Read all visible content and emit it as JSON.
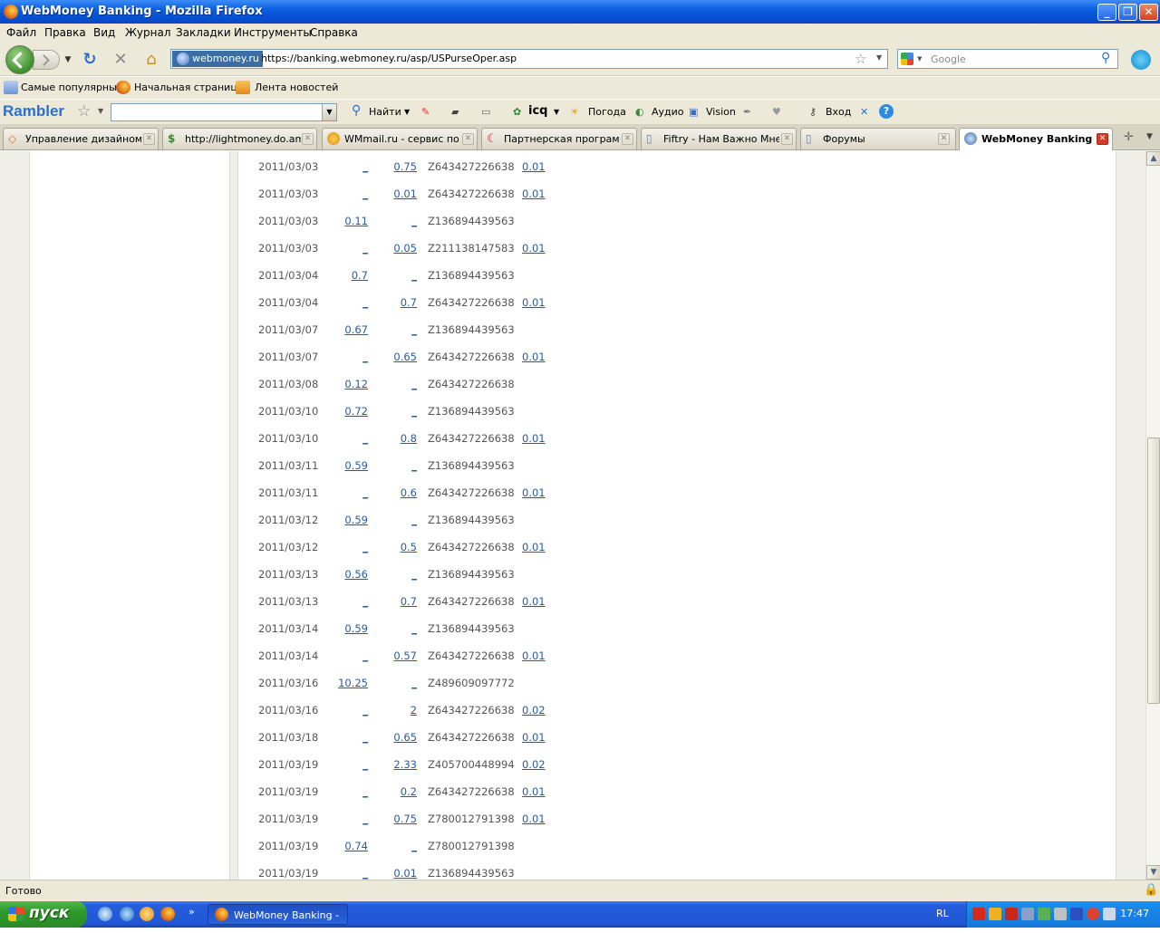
{
  "window": {
    "title": "WebMoney Banking - Mozilla Firefox"
  },
  "menu": [
    "Файл",
    "Правка",
    "Вид",
    "Журнал",
    "Закладки",
    "Инструменты",
    "Справка"
  ],
  "nav": {
    "site_identity": "webmoney.ru",
    "url": "https://banking.webmoney.ru/asp/USPurseOper.asp",
    "search_placeholder": "Google"
  },
  "bookmarks": [
    "Самые популярные",
    "Начальная страница",
    "Лента новостей"
  ],
  "rambler": {
    "logo": "Rambler",
    "find": "Найти",
    "icq": "icq",
    "weather": "Погода",
    "audio": "Аудио",
    "vision": "Vision",
    "login": "Вход"
  },
  "tabs": [
    {
      "label": "Управление дизайном...",
      "active": false
    },
    {
      "label": "http://lightmoney.do.am/",
      "active": false
    },
    {
      "label": "WMmail.ru - сервис по...",
      "active": false
    },
    {
      "label": "Партнерская програм...",
      "active": false
    },
    {
      "label": "Fiftry - Нам Важно Мне...",
      "active": false
    },
    {
      "label": "Форумы",
      "active": false
    },
    {
      "label": "WebMoney Banking",
      "active": true
    }
  ],
  "operations": [
    {
      "date": "2011/03/03",
      "in": "_",
      "out": "0.75",
      "purse": "Z643427226638",
      "fee": "0.01"
    },
    {
      "date": "2011/03/03",
      "in": "_",
      "out": "0.01",
      "purse": "Z643427226638",
      "fee": "0.01"
    },
    {
      "date": "2011/03/03",
      "in": "0.11",
      "out": "_",
      "purse": "Z136894439563",
      "fee": ""
    },
    {
      "date": "2011/03/03",
      "in": "_",
      "out": "0.05",
      "purse": "Z211138147583",
      "fee": "0.01"
    },
    {
      "date": "2011/03/04",
      "in": "0.7",
      "out": "_",
      "purse": "Z136894439563",
      "fee": ""
    },
    {
      "date": "2011/03/04",
      "in": "_",
      "out": "0.7",
      "purse": "Z643427226638",
      "fee": "0.01"
    },
    {
      "date": "2011/03/07",
      "in": "0.67",
      "out": "_",
      "purse": "Z136894439563",
      "fee": ""
    },
    {
      "date": "2011/03/07",
      "in": "_",
      "out": "0.65",
      "purse": "Z643427226638",
      "fee": "0.01"
    },
    {
      "date": "2011/03/08",
      "in": "0.12",
      "out": "_",
      "purse": "Z643427226638",
      "fee": ""
    },
    {
      "date": "2011/03/10",
      "in": "0.72",
      "out": "_",
      "purse": "Z136894439563",
      "fee": ""
    },
    {
      "date": "2011/03/10",
      "in": "_",
      "out": "0.8",
      "purse": "Z643427226638",
      "fee": "0.01"
    },
    {
      "date": "2011/03/11",
      "in": "0.59",
      "out": "_",
      "purse": "Z136894439563",
      "fee": ""
    },
    {
      "date": "2011/03/11",
      "in": "_",
      "out": "0.6",
      "purse": "Z643427226638",
      "fee": "0.01"
    },
    {
      "date": "2011/03/12",
      "in": "0.59",
      "out": "_",
      "purse": "Z136894439563",
      "fee": ""
    },
    {
      "date": "2011/03/12",
      "in": "_",
      "out": "0.5",
      "purse": "Z643427226638",
      "fee": "0.01"
    },
    {
      "date": "2011/03/13",
      "in": "0.56",
      "out": "_",
      "purse": "Z136894439563",
      "fee": ""
    },
    {
      "date": "2011/03/13",
      "in": "_",
      "out": "0.7",
      "purse": "Z643427226638",
      "fee": "0.01"
    },
    {
      "date": "2011/03/14",
      "in": "0.59",
      "out": "_",
      "purse": "Z136894439563",
      "fee": ""
    },
    {
      "date": "2011/03/14",
      "in": "_",
      "out": "0.57",
      "purse": "Z643427226638",
      "fee": "0.01"
    },
    {
      "date": "2011/03/16",
      "in": "10.25",
      "out": "_",
      "purse": "Z489609097772",
      "fee": ""
    },
    {
      "date": "2011/03/16",
      "in": "_",
      "out": "2",
      "purse": "Z643427226638",
      "fee": "0.02"
    },
    {
      "date": "2011/03/18",
      "in": "_",
      "out": "0.65",
      "purse": "Z643427226638",
      "fee": "0.01"
    },
    {
      "date": "2011/03/19",
      "in": "_",
      "out": "2.33",
      "purse": "Z405700448994",
      "fee": "0.02"
    },
    {
      "date": "2011/03/19",
      "in": "_",
      "out": "0.2",
      "purse": "Z643427226638",
      "fee": "0.01"
    },
    {
      "date": "2011/03/19",
      "in": "_",
      "out": "0.75",
      "purse": "Z780012791398",
      "fee": "0.01"
    },
    {
      "date": "2011/03/19",
      "in": "0.74",
      "out": "_",
      "purse": "Z780012791398",
      "fee": ""
    },
    {
      "date": "2011/03/19",
      "in": "_",
      "out": "0.01",
      "purse": "Z136894439563",
      "fee": ""
    }
  ],
  "status": {
    "text": "Готово"
  },
  "taskbar": {
    "start": "пуск",
    "app": "WebMoney Banking - ...",
    "lang": "RL",
    "clock": "17:47"
  }
}
